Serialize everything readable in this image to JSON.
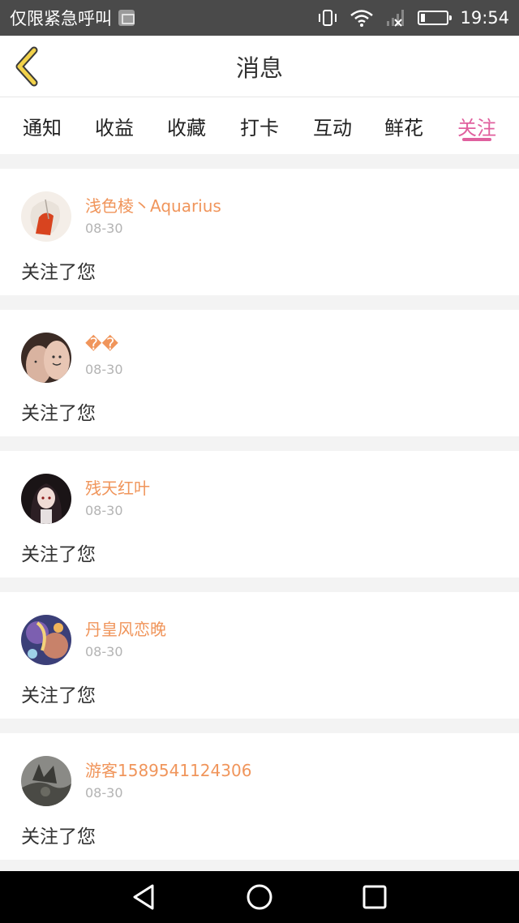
{
  "status_bar": {
    "carrier_text": "仅限紧急呼叫",
    "time": "19:54",
    "icons": [
      "image-notification-icon",
      "vibrate-icon",
      "wifi-icon",
      "no-signal-icon",
      "battery-icon"
    ]
  },
  "header": {
    "title": "消息",
    "back_icon": "chevron-left-icon"
  },
  "tabs": [
    {
      "label": "通知",
      "active": false
    },
    {
      "label": "收益",
      "active": false
    },
    {
      "label": "收藏",
      "active": false
    },
    {
      "label": "打卡",
      "active": false
    },
    {
      "label": "互动",
      "active": false
    },
    {
      "label": "鲜花",
      "active": false
    },
    {
      "label": "关注",
      "active": true
    }
  ],
  "feed": [
    {
      "username": "浅色棱丶Aquarius",
      "date": "08-30",
      "message": "关注了您"
    },
    {
      "username": "��",
      "date": "08-30",
      "message": "关注了您"
    },
    {
      "username": "残天红叶",
      "date": "08-30",
      "message": "关注了您"
    },
    {
      "username": "丹皇风恋晚",
      "date": "08-30",
      "message": "关注了您"
    },
    {
      "username": "游客1589541124306",
      "date": "08-30",
      "message": "关注了您"
    }
  ],
  "nav_bar": {
    "icons": [
      "back-triangle-icon",
      "home-circle-icon",
      "recents-square-icon"
    ]
  },
  "colors": {
    "accent": "#e0609e",
    "username": "#f0955b",
    "back_chevron": "#f2d24a"
  }
}
